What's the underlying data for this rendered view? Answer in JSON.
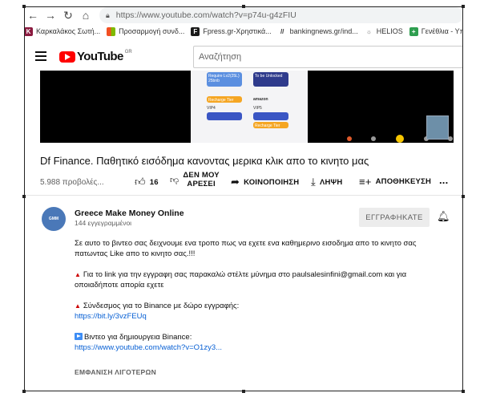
{
  "browser": {
    "url": "https://www.youtube.com/watch?v=p74u-g4zFIU",
    "bookmarks": [
      {
        "label": "Καρκαλάκος Σωτή...",
        "color": "#8b1a3f",
        "glyph": "K"
      },
      {
        "label": "Προσαρμογή συνδ...",
        "color": "#f25022",
        "glyph": "■"
      },
      {
        "label": "Fpress.gr-Χρηστικά...",
        "color": "#1a1a1a",
        "glyph": "F"
      },
      {
        "label": "bankingnews.gr/ind...",
        "color": "#555555",
        "glyph": "//"
      },
      {
        "label": "HELIOS",
        "color": "#999999",
        "glyph": "☼"
      },
      {
        "label": "Γενέθλια - Υπολογ",
        "color": "#2e9e4f",
        "glyph": "+"
      }
    ]
  },
  "header": {
    "logo_text": "YouTube",
    "region": "GR",
    "search_placeholder": "Αναζήτηση"
  },
  "video": {
    "app_tiles": [
      "Require Lv2(25L) 25bnb",
      "To be Unlocked",
      "Recharge Tier",
      "amazon",
      "VIP4",
      "VIP5",
      "Recharge Tier"
    ]
  },
  "title": "Df Finance. Παθητικό εισόδημα κανοντας μερικα κλικ απο το κινητο μας",
  "meta": {
    "views": "5.988 προβολές...",
    "likes": "16",
    "dislike_line1": "ΔΕΝ ΜΟΥ",
    "dislike_line2": "ΑΡΕΣΕΙ",
    "share": "ΚΟΙΝΟΠΟΙΗΣΗ",
    "download": "ΛΗΨΗ",
    "save": "ΑΠΟΘΗΚΕΥΣΗ",
    "more": "..."
  },
  "channel": {
    "avatar_text": "GMM",
    "name": "Greece Make Money Online",
    "subs": "144 εγγεγραμμένοι",
    "subscribe_label": "ΕΓΓΡΑΦΗΚΑΤΕ"
  },
  "description": {
    "p1": "Σε αυτο το βιντεο σας δειχνουμε ενα τροπο πως να εχετε ενα καθημερινο εισοδημα απο το κινητο σας πατωντας Like απο το κινητο σας.!!!",
    "p2": "Για το link για την εγγραφη σας παρακαλώ στέλτε μύνημα στο paulsalesinfini@gmail.com και για οποιαδήποτε απορία εχετε",
    "p3_label": "Σύνδεσμος για το Binance με δώρο εγγραφής:",
    "p3_link": "https://bit.ly/3vzFEUq",
    "p4_label": "Βιντεο για δημιουργεια Binance:",
    "p4_link": "https://www.youtube.com/watch?v=O1zy3...",
    "show_less": "ΕΜΦΑΝΙΣΗ ΛΙΓΟΤΕΡΩΝ"
  },
  "colors": {
    "yt_red": "#ff0000",
    "link_blue": "#065fd4",
    "secondary_text": "#606060"
  }
}
